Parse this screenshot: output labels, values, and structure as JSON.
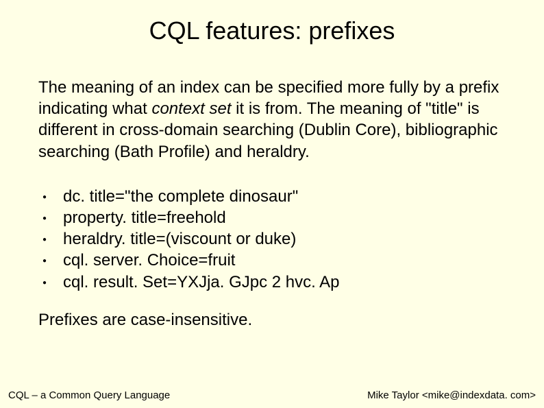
{
  "title": "CQL features: prefixes",
  "paragraph_parts": {
    "p1": "The meaning of an index can be specified more fully by a prefix indicating what ",
    "italic": "context set",
    "p2": " it is from.  The meaning of \"title\" is different in cross-domain searching (Dublin Core), bibliographic searching (Bath Profile) and heraldry."
  },
  "examples": [
    "dc. title=\"the complete dinosaur\"",
    "property. title=freehold",
    "heraldry. title=(viscount or duke)",
    "cql. server. Choice=fruit",
    "cql. result. Set=YXJja. GJpc 2 hvc. Ap"
  ],
  "closing": "Prefixes are case-insensitive.",
  "footer": {
    "left": "CQL – a Common Query Language",
    "right": "Mike Taylor <mike@indexdata. com>"
  }
}
